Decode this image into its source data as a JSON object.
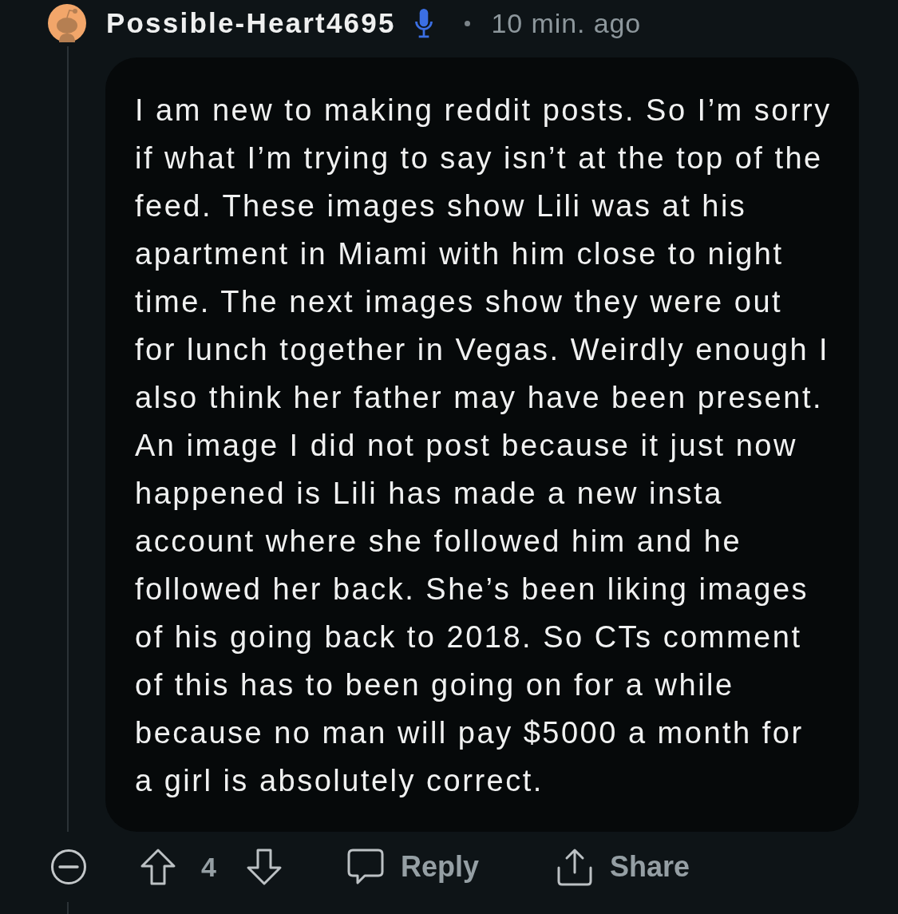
{
  "comment": {
    "author": "Possible-Heart4695",
    "timestamp": "10 min. ago",
    "body": "I am new to making reddit posts. So I’m sorry if what I’m trying to say isn’t at the top of the feed. These images show Lili was at his apartment in Miami with him close to night time. The next images show they were out for lunch together in Vegas. Weirdly enough I also think her father may have been present. An image I did not post because it just now happened is Lili has made a new insta account where she followed him and he followed her back. She’s been liking images of his going back to 2018. So CTs comment of this has to been going on for a while because no man will pay $5000 a month for a girl is absolutely correct."
  },
  "actions": {
    "score": "4",
    "reply": "Reply",
    "share": "Share"
  }
}
